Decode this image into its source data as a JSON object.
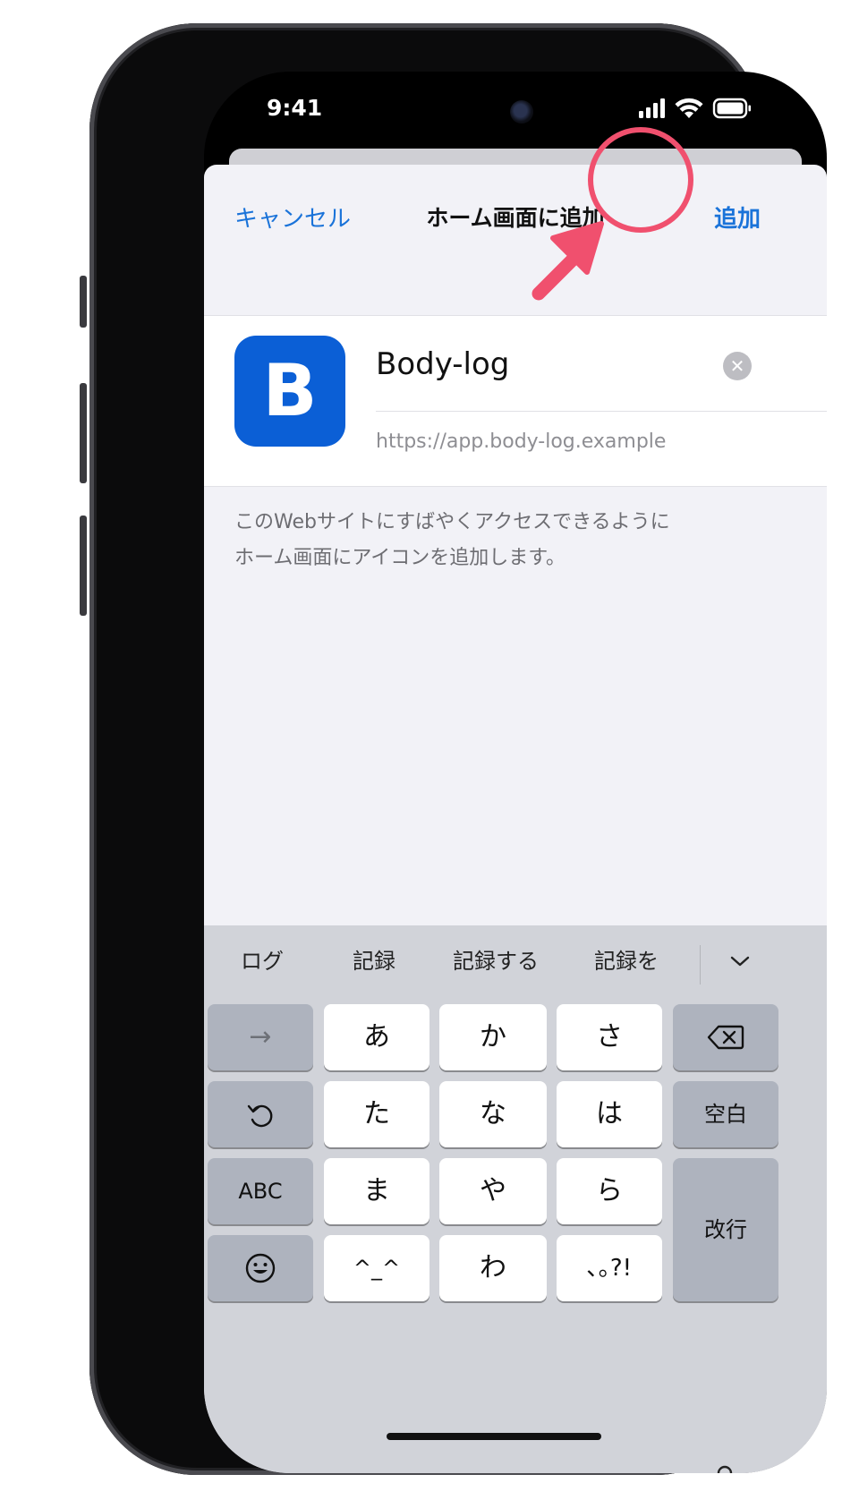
{
  "status_bar": {
    "time": "9:41"
  },
  "nav": {
    "cancel_label": "キャンセル",
    "title": "ホーム画面に追加",
    "add_label": "追加"
  },
  "app": {
    "icon_letter": "B",
    "icon_color": "#0b5fd6",
    "name": "Body-log",
    "url": "https://app.body-log.example"
  },
  "description": {
    "line1": "このWebサイトにすばやくアクセスできるように",
    "line2": "ホーム画面にアイコンを追加します。"
  },
  "keyboard": {
    "candidates": [
      "ログ",
      "記録",
      "記録する",
      "記録を"
    ],
    "rows": {
      "r1": [
        "あ",
        "か",
        "さ"
      ],
      "r2": [
        "た",
        "な",
        "は"
      ],
      "r3": [
        "ま",
        "や",
        "ら"
      ],
      "r4": [
        "^_^",
        "わ",
        "､｡?!"
      ]
    },
    "next_label": "→",
    "abc_label": "ABC",
    "space_label": "空白",
    "return_label": "改行"
  },
  "highlight_color": "#f0506e",
  "accent_color": "#1a73d9"
}
